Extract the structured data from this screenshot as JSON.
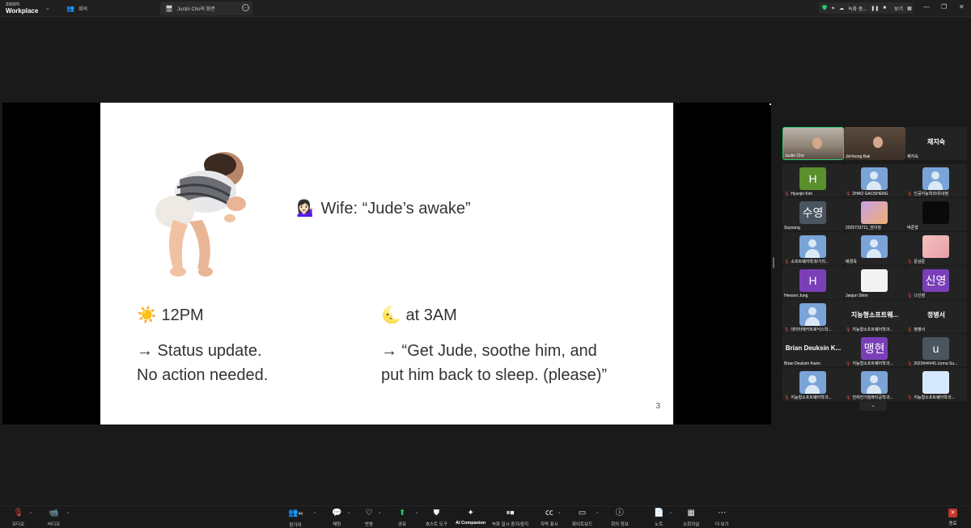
{
  "topbar": {
    "brand_small": "zoom",
    "brand": "Workplace",
    "tab_meeting": "회의",
    "tab_share": "Justin Cho의 화면",
    "rec_status": "녹화 중...",
    "view_label": "보기"
  },
  "slide": {
    "wife_line": "💁🏻‍♀️ Wife: “Jude’s awake”",
    "left_heading": "☀️ 12PM",
    "right_heading": "🌜 at 3AM",
    "left_line1": "→ Status update.",
    "left_line2": "No action needed.",
    "right_line1": "→ “Get Jude, soothe him, and",
    "right_line2": "put him back to sleep. (please)”",
    "page_number": "3"
  },
  "gallery": {
    "tiles": [
      {
        "name": "Justin Cho",
        "muted": false,
        "kind": "video"
      },
      {
        "name": "JinYeong Bak",
        "muted": false,
        "kind": "video"
      },
      {
        "name": "채지숙",
        "big": "채지숙",
        "muted": false,
        "kind": "name"
      },
      {
        "name": "Hyunjin Kim",
        "letter": "H",
        "color": "#5a8f2e",
        "muted": true
      },
      {
        "name": "ZHAO GAOSHENG",
        "muted": true,
        "kind": "person"
      },
      {
        "name": "인공지능학과/유내정",
        "muted": true,
        "kind": "person"
      },
      {
        "name": "Suyoung",
        "letter": "수영",
        "color": "#4a5560",
        "muted": false
      },
      {
        "name": "2025713711_엄이징",
        "muted": false,
        "kind": "photo"
      },
      {
        "name": "박준형",
        "muted": false,
        "kind": "dark"
      },
      {
        "name": "소프트웨어학과/기리...",
        "muted": true,
        "kind": "person"
      },
      {
        "name": "배경욱",
        "muted": false,
        "kind": "person"
      },
      {
        "name": "문상준",
        "muted": true,
        "kind": "pink"
      },
      {
        "name": "Heesoo Jung",
        "letter": "H",
        "color": "#7a3fb8",
        "muted": false
      },
      {
        "name": "Jaejun Shim",
        "muted": false,
        "kind": "portrait"
      },
      {
        "name": "나신영",
        "letter": "신영",
        "color": "#7a3fb8",
        "muted": true
      },
      {
        "name": "데이터에카트로닉스학...",
        "muted": true,
        "kind": "person"
      },
      {
        "name": "지능형소프트웨어학과...",
        "big": "지능형소프트웨...",
        "muted": true,
        "kind": "name"
      },
      {
        "name": "정병서",
        "big": "정병서",
        "muted": true,
        "kind": "name"
      },
      {
        "name": "Brian Deuksin Kwon",
        "big": "Brian Deuksin K...",
        "muted": false,
        "kind": "name"
      },
      {
        "name": "지능형소프트웨어학과...",
        "letter": "맹현",
        "color": "#7a3fb8",
        "muted": true
      },
      {
        "name": "2023####41.Uzma Su...",
        "letter": "u",
        "color": "#4a5560",
        "muted": true
      },
      {
        "name": "지능형소프트웨어학과...",
        "muted": true,
        "kind": "person"
      },
      {
        "name": "전자전기컴퓨터공학과...",
        "muted": true,
        "kind": "person"
      },
      {
        "name": "지능형소프트웨어학과...",
        "muted": true,
        "kind": "lightblue"
      }
    ]
  },
  "toolbar": {
    "audio": "오디오",
    "video": "비디오",
    "participants": "참가자",
    "participants_count": "44",
    "chat": "채팅",
    "react": "반응",
    "share": "공유",
    "host_tools": "호스트 도구",
    "ai_companion": "AI Companion",
    "record": "녹화 일시 중지/중지",
    "captions": "자막 표시",
    "whiteboard": "화이트보드",
    "meeting_info": "회의 정보",
    "notes": "노트",
    "breakout": "소회의실",
    "more": "더 보기",
    "end": "종료"
  },
  "colors": {
    "accent_green": "#2ecc71",
    "end_red": "#c0392b",
    "mic_red": "#e74c3c"
  }
}
